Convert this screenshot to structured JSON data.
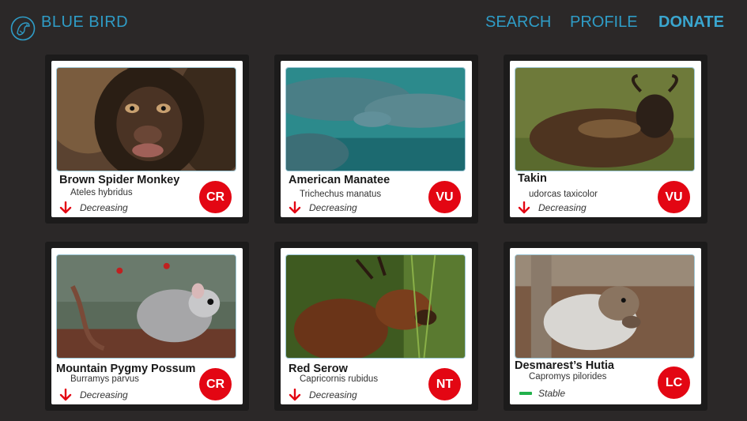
{
  "header": {
    "brand": "BLUE BIRD",
    "nav": {
      "search": "SEARCH",
      "profile": "PROFILE",
      "donate": "DONATE"
    }
  },
  "colors": {
    "accent": "#2f9cc6",
    "badge": "#e30613",
    "decreasing": "#e30613",
    "stable": "#22b14c"
  },
  "cards": [
    {
      "name": "Brown Spider Monkey",
      "scientific": "Ateles hybridus",
      "trend": "Decreasing",
      "trend_icon": "arrow-down-icon",
      "status": "CR"
    },
    {
      "name": "American Manatee",
      "scientific": "Trichechus manatus",
      "trend": "Decreasing",
      "trend_icon": "arrow-down-icon",
      "status": "VU"
    },
    {
      "name": "Takin",
      "scientific": "udorcas taxicolor",
      "trend": "Decreasing",
      "trend_icon": "arrow-down-icon",
      "status": "VU"
    },
    {
      "name": "Mountain Pygmy Possum",
      "scientific": "Burramys parvus",
      "trend": "Decreasing",
      "trend_icon": "arrow-down-icon",
      "status": "CR"
    },
    {
      "name": "Red Serow",
      "scientific": "Capricornis rubidus",
      "trend": "Decreasing",
      "trend_icon": "arrow-down-icon",
      "status": "NT"
    },
    {
      "name": "Desmarest’s Hutia",
      "scientific": "Capromys pilorides",
      "trend": "Stable",
      "trend_icon": "dash-icon",
      "status": "LC"
    }
  ]
}
